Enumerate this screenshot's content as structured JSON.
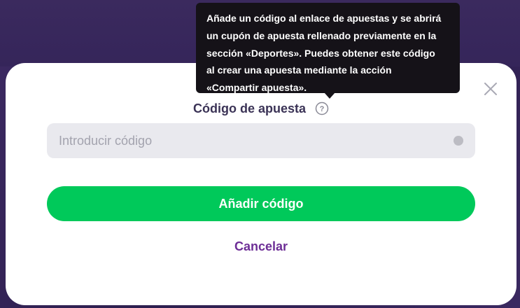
{
  "modal": {
    "close_icon": "close-icon",
    "label": "Código de apuesta",
    "help_icon": "question-circle-icon",
    "input": {
      "value": "",
      "placeholder": "Introducir código",
      "status_icon": "dot-icon"
    },
    "primary_button": "Añadir código",
    "cancel_link": "Cancelar"
  },
  "tooltip": {
    "lines": [
      "Añade un código al enlace de apuestas y se abrirá",
      "un cupón de apuesta rellenado previamente en la",
      "sección «Deportes». Puedes obtener este código",
      "al crear una apuesta mediante la acción",
      "«Compartir apuesta»."
    ]
  },
  "colors": {
    "accent_green": "#00c95a",
    "link_purple": "#6d2e96",
    "backdrop": "#35255a",
    "tooltip_bg": "#151218"
  }
}
